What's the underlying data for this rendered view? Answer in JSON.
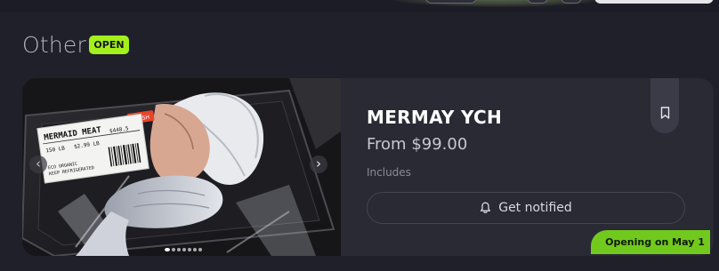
{
  "section": {
    "title": "Other",
    "status_badge": "OPEN"
  },
  "product": {
    "title": "MERMAY YCH",
    "price": "From $99.00",
    "includes_label": "Includes",
    "notify_label": "Get notified",
    "opening_badge": "Opening on May 1",
    "image": {
      "label_title": "MERMAID MEAT",
      "label_lines": [
        "ECO ORGANIC",
        "KEEP REFRIGERATED"
      ],
      "label_weight": "150 LB",
      "label_price": "$2.99 LB",
      "label_total": "$448.5",
      "sticker": "FRESH",
      "carousel_total_slides": 7,
      "carousel_active_slide": 1
    },
    "icons": {
      "prev": "chevron-left-icon",
      "next": "chevron-right-icon",
      "bookmark": "bookmark-icon",
      "bell": "bell-icon"
    }
  },
  "colors": {
    "page_background": "#20202b",
    "card_background": "#2a2a35",
    "open_badge": "#a4f01c",
    "opening_badge": "#72c91e"
  }
}
